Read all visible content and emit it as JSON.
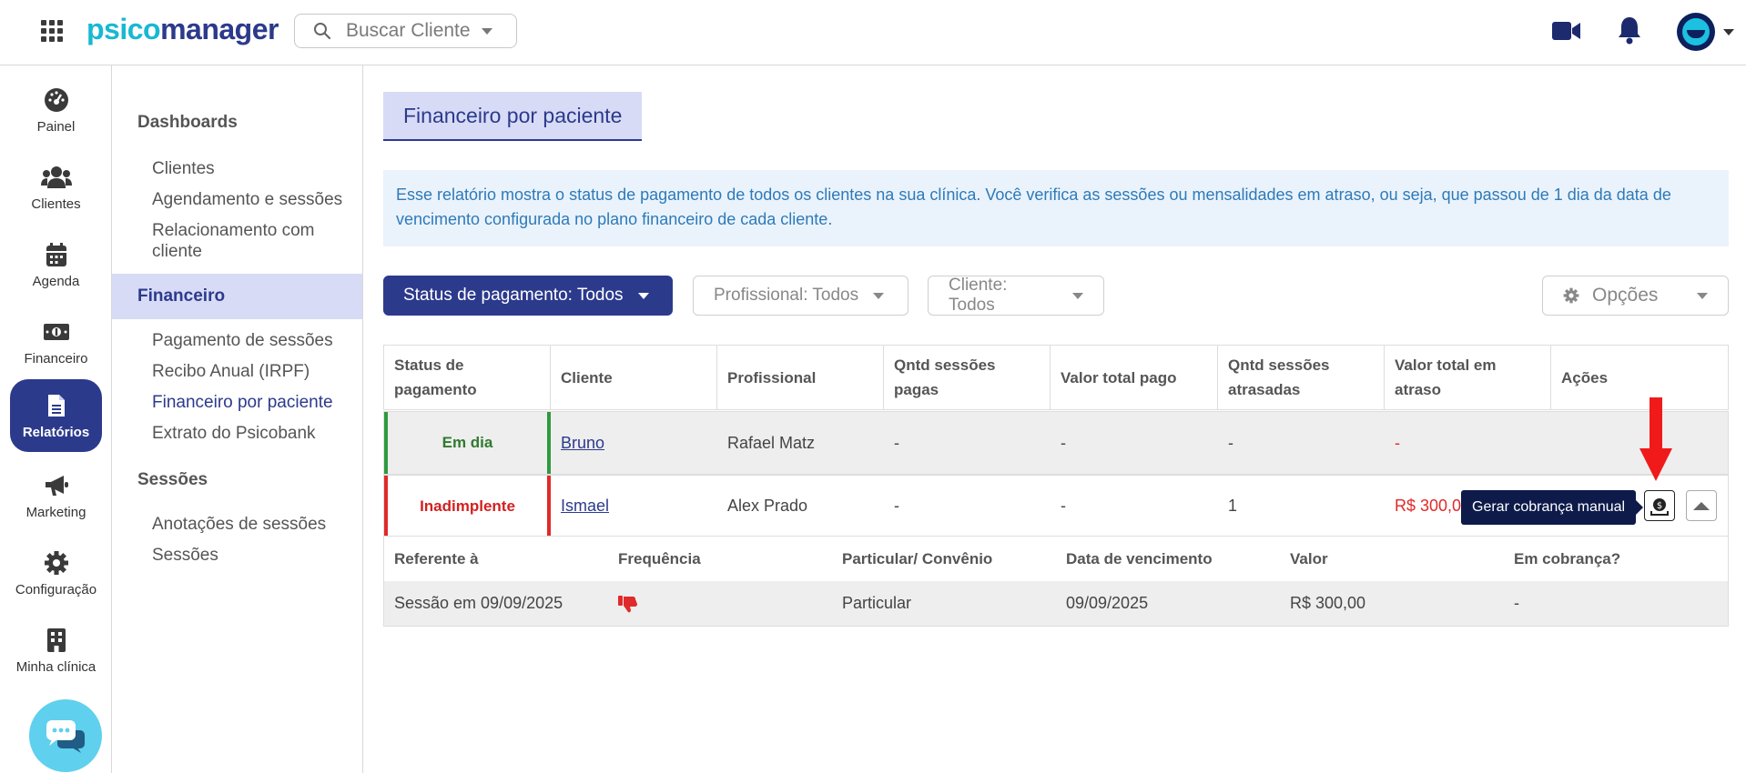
{
  "header": {
    "logo_part1": "psico",
    "logo_part2": "manager",
    "search_placeholder": "Buscar Cliente"
  },
  "rail": {
    "items": [
      {
        "label": "Painel",
        "icon": "dashboard-gauge-icon"
      },
      {
        "label": "Clientes",
        "icon": "users-icon"
      },
      {
        "label": "Agenda",
        "icon": "calendar-icon"
      },
      {
        "label": "Financeiro",
        "icon": "money-icon"
      },
      {
        "label": "Relatórios",
        "icon": "report-document-icon",
        "active": true
      },
      {
        "label": "Marketing",
        "icon": "megaphone-icon"
      },
      {
        "label": "Configuração",
        "icon": "gear-icon"
      },
      {
        "label": "Minha clínica",
        "icon": "building-icon"
      }
    ]
  },
  "subnav": {
    "dashboards": "Dashboards",
    "clientes": "Clientes",
    "agendamento": "Agendamento e sessões",
    "relacionamento": "Relacionamento com cliente",
    "financeiro": "Financeiro",
    "pagamento": "Pagamento de sessões",
    "recibo": "Recibo Anual (IRPF)",
    "fin_paciente": "Financeiro por paciente",
    "extrato": "Extrato do Psicobank",
    "sessoes_title": "Sessões",
    "anotacoes": "Anotações de sessões",
    "sessoes": "Sessões"
  },
  "main": {
    "title": "Financeiro por paciente",
    "info": "Esse relatório mostra o status de pagamento de todos os clientes na sua clínica. Você verifica as sessões ou mensalidades em atraso, ou seja, que passou de 1 dia da data de vencimento configurada no plano financeiro de cada cliente.",
    "filters": {
      "status": "Status de pagamento: Todos",
      "profissional": "Profissional: Todos",
      "cliente": "Cliente: Todos",
      "opcoes": "Opções"
    },
    "table": {
      "headers": [
        "Status de pagamento",
        "Cliente",
        "Profissional",
        "Qntd sessões pagas",
        "Valor total pago",
        "Qntd sessões atrasadas",
        "Valor total em atraso",
        "Ações"
      ],
      "rows": [
        {
          "status": "Em dia",
          "cliente": "Bruno",
          "profissional": "Rafael Matz",
          "qtd_pagas": "-",
          "valor_pago": "-",
          "qtd_atrasadas": "-",
          "valor_atraso": "-"
        },
        {
          "status": "Inadimplente",
          "cliente": "Ismael",
          "profissional": "Alex Prado",
          "qtd_pagas": "-",
          "valor_pago": "-",
          "qtd_atrasadas": "1",
          "valor_atraso": "R$ 300,00"
        }
      ]
    },
    "detail": {
      "headers": [
        "Referente à",
        "Frequência",
        "Particular/ Convênio",
        "Data de vencimento",
        "Valor",
        "Em cobrança?"
      ],
      "row": {
        "referente": "Sessão em 09/09/2025",
        "frequencia_icon": "thumbs-down-icon",
        "tipo": "Particular",
        "vencimento": "09/09/2025",
        "valor": "R$ 300,00",
        "cobranca": "-"
      }
    },
    "tooltip": "Gerar cobrança manual"
  },
  "colors": {
    "brand_dark": "#2c3a8c",
    "brand_cyan": "#18b8d1",
    "ok_green": "#2f9a3f",
    "alert_red": "#e02a2a"
  }
}
